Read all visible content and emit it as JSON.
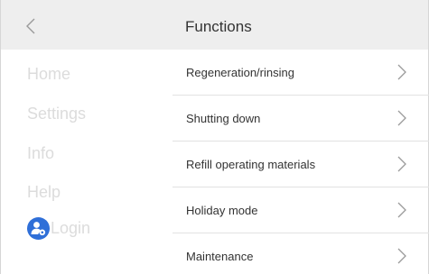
{
  "header": {
    "title": "Functions",
    "back_icon": "chevron-left-icon"
  },
  "sidebar": {
    "items": [
      {
        "label": "Home"
      },
      {
        "label": "Settings"
      },
      {
        "label": "Info"
      },
      {
        "label": "Help"
      }
    ],
    "login": {
      "label": "Login",
      "icon": "user-wrench-icon"
    }
  },
  "functions": {
    "items": [
      {
        "label": "Regeneration/rinsing"
      },
      {
        "label": "Shutting down"
      },
      {
        "label": "Refill operating materials"
      },
      {
        "label": "Holiday mode"
      },
      {
        "label": "Maintenance"
      }
    ],
    "chevron_icon": "chevron-right-icon"
  },
  "colors": {
    "header_bg": "#eeeeee",
    "sidebar_text": "#dcdcdc",
    "text": "#333333",
    "accent": "#2f6fd8"
  }
}
